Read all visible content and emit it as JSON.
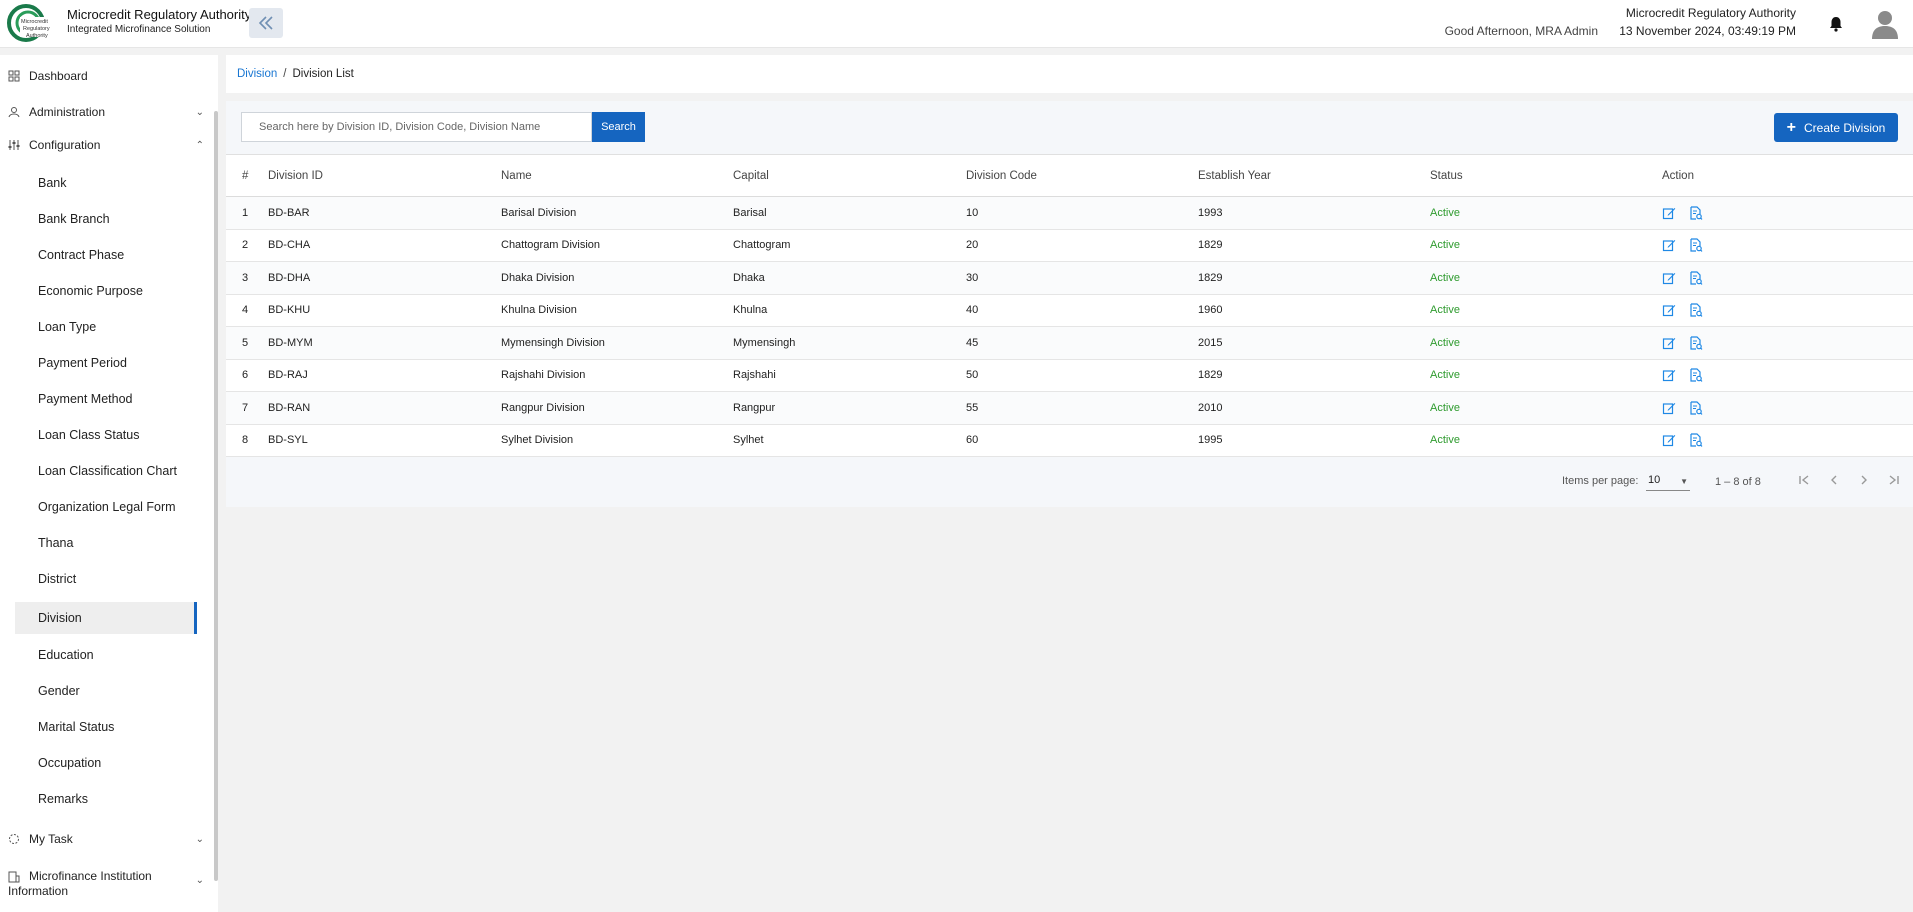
{
  "header": {
    "org_title": "Microcredit Regulatory Authority",
    "org_subtitle": "Integrated Microfinance Solution",
    "logo_text_1": "Microcredit",
    "logo_text_2": "Regulatory",
    "logo_text_3": "Authority",
    "greeting": "Good Afternoon, MRA Admin",
    "right_title": "Microcredit Regulatory Authority",
    "datetime": "13 November 2024, 03:49:19 PM"
  },
  "sidebar": {
    "dashboard": "Dashboard",
    "administration": "Administration",
    "configuration": "Configuration",
    "items": [
      {
        "label": "Bank"
      },
      {
        "label": "Bank Branch"
      },
      {
        "label": "Contract Phase"
      },
      {
        "label": "Economic Purpose"
      },
      {
        "label": "Loan Type"
      },
      {
        "label": "Payment Period"
      },
      {
        "label": "Payment Method"
      },
      {
        "label": "Loan Class Status"
      },
      {
        "label": "Loan Classification Chart"
      },
      {
        "label": "Organization Legal Form"
      },
      {
        "label": "Thana"
      },
      {
        "label": "District"
      },
      {
        "label": "Division"
      },
      {
        "label": "Education"
      },
      {
        "label": "Gender"
      },
      {
        "label": "Marital Status"
      },
      {
        "label": "Occupation"
      },
      {
        "label": "Remarks"
      }
    ],
    "active_item": "Division",
    "my_task": "My Task",
    "mfi_info_line1": "Microfinance Institution",
    "mfi_info_line2": "Information"
  },
  "breadcrumb": {
    "parent": "Division",
    "separator": "/",
    "current": "Division List"
  },
  "toolbar": {
    "search_placeholder": "Search here by Division ID, Division Code, Division Name",
    "search_label": "Search",
    "create_label": "Create Division"
  },
  "table": {
    "columns": [
      "#",
      "Division ID",
      "Name",
      "Capital",
      "Division Code",
      "Establish Year",
      "Status",
      "Action"
    ],
    "rows": [
      {
        "num": "1",
        "id": "BD-BAR",
        "name": "Barisal Division",
        "capital": "Barisal",
        "code": "10",
        "year": "1993",
        "status": "Active"
      },
      {
        "num": "2",
        "id": "BD-CHA",
        "name": "Chattogram Division",
        "capital": "Chattogram",
        "code": "20",
        "year": "1829",
        "status": "Active"
      },
      {
        "num": "3",
        "id": "BD-DHA",
        "name": "Dhaka Division",
        "capital": "Dhaka",
        "code": "30",
        "year": "1829",
        "status": "Active"
      },
      {
        "num": "4",
        "id": "BD-KHU",
        "name": "Khulna Division",
        "capital": "Khulna",
        "code": "40",
        "year": "1960",
        "status": "Active"
      },
      {
        "num": "5",
        "id": "BD-MYM",
        "name": "Mymensingh Division",
        "capital": "Mymensingh",
        "code": "45",
        "year": "2015",
        "status": "Active"
      },
      {
        "num": "6",
        "id": "BD-RAJ",
        "name": "Rajshahi Division",
        "capital": "Rajshahi",
        "code": "50",
        "year": "1829",
        "status": "Active"
      },
      {
        "num": "7",
        "id": "BD-RAN",
        "name": "Rangpur Division",
        "capital": "Rangpur",
        "code": "55",
        "year": "2010",
        "status": "Active"
      },
      {
        "num": "8",
        "id": "BD-SYL",
        "name": "Sylhet Division",
        "capital": "Sylhet",
        "code": "60",
        "year": "1995",
        "status": "Active"
      }
    ]
  },
  "pagination": {
    "items_per_page_label": "Items per page:",
    "items_per_page": "10",
    "range": "1 – 8 of 8"
  },
  "colors": {
    "primary": "#1565c0",
    "link": "#1976d2",
    "status_active": "#2e9b2e",
    "action_icon": "#1e88e5"
  },
  "icons": {
    "logo": "mra-logo",
    "collapse": "double-chevron-left-icon",
    "bell": "bell-icon",
    "avatar": "user-avatar-icon",
    "edit": "edit-icon",
    "details": "document-view-icon"
  }
}
